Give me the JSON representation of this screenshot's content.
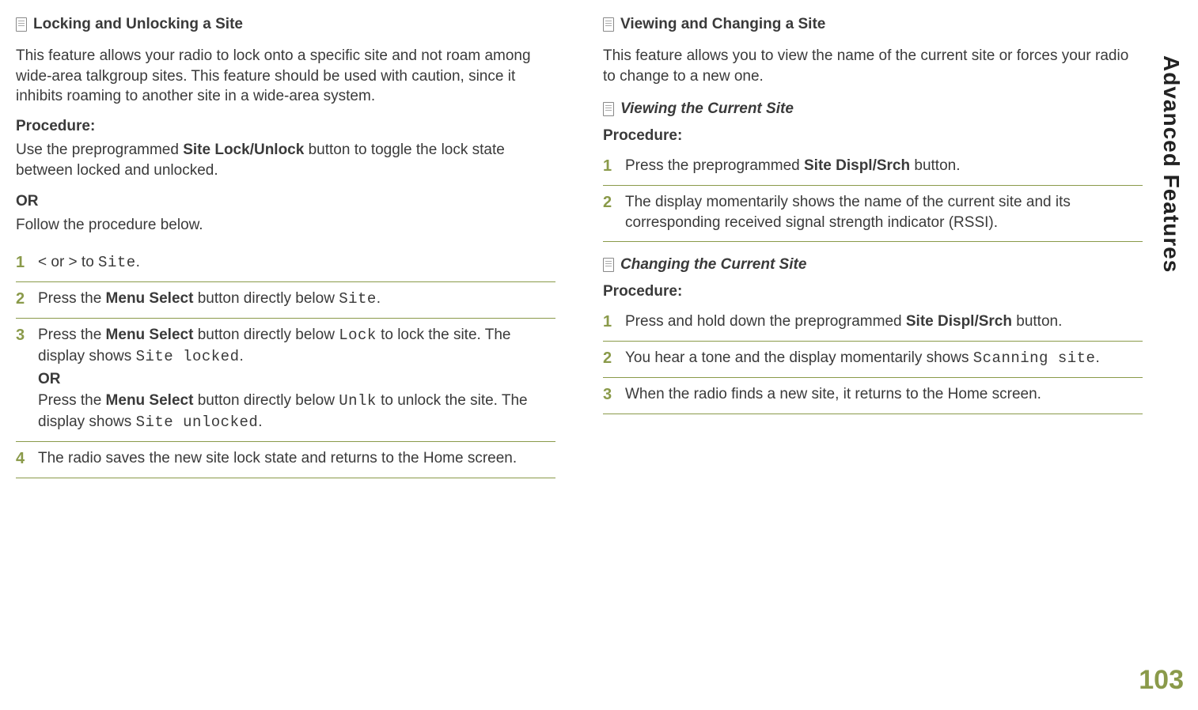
{
  "side_label": "Advanced Features",
  "page_number": "103",
  "left": {
    "title": "Locking and Unlocking a Site",
    "intro": "This feature allows your radio to lock onto a specific site and not roam among wide-area talkgroup sites. This feature should be used with caution, since it inhibits roaming to another site in a wide-area system.",
    "procedure_label": "Procedure:",
    "proc_line_a": "Use the preprogrammed ",
    "proc_line_b": "Site Lock/Unlock",
    "proc_line_c": " button to toggle the lock state between locked and unlocked.",
    "or_label": "OR",
    "follow": "Follow the procedure below.",
    "steps": {
      "s1_a": "< or > to ",
      "s1_code": "Site",
      "s1_c": ".",
      "s2_a": "Press the ",
      "s2_b": "Menu Select",
      "s2_c": " button directly below ",
      "s2_code": "Site",
      "s2_e": ".",
      "s3_a": "Press the ",
      "s3_b": "Menu Select",
      "s3_c": " button directly below ",
      "s3_code1": "Lock",
      "s3_d": " to lock the site. The display shows ",
      "s3_code2": "Site locked",
      "s3_e": ".",
      "s3_or": "OR",
      "s3_f": "Press the ",
      "s3_g": "Menu Select",
      "s3_h": " button directly below ",
      "s3_code3": "Unlk",
      "s3_i": " to unlock the site. The display shows ",
      "s3_code4": "Site unlocked",
      "s3_j": ".",
      "s4": "The radio saves the new site lock state and returns to the Home screen."
    }
  },
  "right": {
    "title": "Viewing and Changing a Site",
    "intro": "This feature allows you to view the name of the current site or forces your radio to change to a new one.",
    "sub1_title": "Viewing the Current Site",
    "procedure_label": "Procedure:",
    "sub1_steps": {
      "s1_a": "Press the preprogrammed ",
      "s1_b": "Site Displ/Srch",
      "s1_c": " button.",
      "s2": "The display momentarily shows the name of the current site and its corresponding received signal strength indicator (RSSI)."
    },
    "sub2_title": "Changing the Current Site",
    "sub2_steps": {
      "s1_a": "Press and hold down the preprogrammed ",
      "s1_b": "Site Displ/Srch",
      "s1_c": " button.",
      "s2_a": "You hear a tone and the display momentarily shows ",
      "s2_code": "Scanning site",
      "s2_c": ".",
      "s3": "When the radio finds a new site, it returns to the Home screen."
    }
  }
}
